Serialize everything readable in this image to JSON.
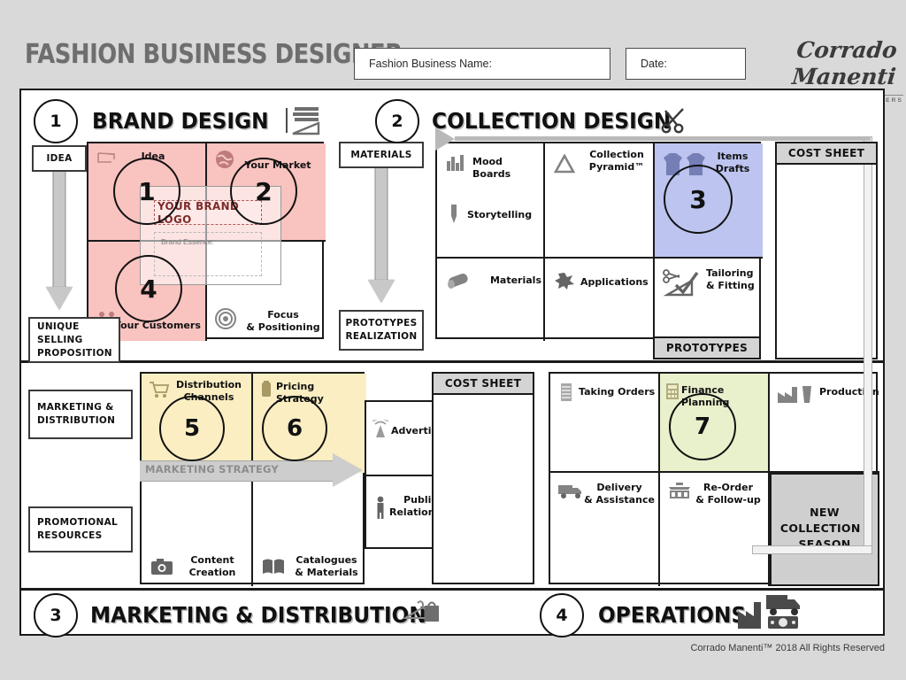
{
  "header": {
    "title": "FASHION BUSINESS DESIGNER",
    "business_name_field": {
      "label": "Fashion Business Name:",
      "value": ""
    },
    "date_field": {
      "label": "Date:",
      "value": ""
    },
    "logo": {
      "name": "Corrado Manenti",
      "tagline": "DESIGNER OF DESIGNERS"
    }
  },
  "sections": {
    "brand_design": {
      "number": "1",
      "title": "BRAND DESIGN"
    },
    "collection_design": {
      "number": "2",
      "title": "COLLECTION DESIGN"
    },
    "marketing_distribution": {
      "number": "3",
      "title": "MARKETING & DISTRIBUTION"
    },
    "operations": {
      "number": "4",
      "title": "OPERATIONS"
    }
  },
  "flow_boxes": {
    "idea": "IDEA",
    "unique_selling_proposition": "UNIQUE SELLING PROPOSITION",
    "marketing_distribution": "MARKETING & DISTRIBUTION",
    "promotional_resources": "PROMOTIONAL RESOURCES",
    "materials": "MATERIALS",
    "prototypes_realization": "PROTOTYPES REALIZATION"
  },
  "brand_grid": {
    "cells": [
      {
        "label": "Idea",
        "icon": "compass-icon"
      },
      {
        "label": "Your Market",
        "icon": "globe-icon"
      },
      {
        "label": "Your Customers",
        "icon": "people-icon"
      },
      {
        "label": "Focus\n& Positioning",
        "icon": "target-icon"
      }
    ],
    "logo_placeholder": "YOUR BRAND LOGO",
    "brand_essence_label": "Brand Essence:"
  },
  "collection_grid": {
    "cells": [
      {
        "label": "Mood Boards",
        "icon": "moodboard-icon"
      },
      {
        "label": "Storytelling",
        "icon": "pen-icon"
      },
      {
        "label": "Collection\nPyramid™",
        "icon": "triangle-icon"
      },
      {
        "label": "Applications",
        "icon": "splatter-icon"
      },
      {
        "label": "Items\nDrafts",
        "icon": "garments-icon"
      },
      {
        "label": "Tailoring\n& Fitting",
        "icon": "scissors-ruler-icon"
      },
      {
        "label": "Materials",
        "icon": "fabric-roll-icon"
      }
    ],
    "prototypes_banner": "PROTOTYPES",
    "cost_sheet_banner": "COST SHEET"
  },
  "marketing_grid": {
    "cells": [
      {
        "label": "Distribution\nChannels",
        "icon": "cart-icon"
      },
      {
        "label": "Pricing Strategy",
        "icon": "pricetag-icon"
      },
      {
        "label": "Content\nCreation",
        "icon": "camera-icon"
      },
      {
        "label": "Catalogues\n& Materials",
        "icon": "book-icon"
      },
      {
        "label": "Advertising",
        "icon": "broadcast-icon"
      },
      {
        "label": "Public\nRelationship",
        "icon": "person-icon"
      }
    ],
    "strategy_label": "MARKETING STRATEGY",
    "cost_sheet_banner": "COST SHEET"
  },
  "operations_grid": {
    "cells": [
      {
        "label": "Taking Orders",
        "icon": "ledger-icon"
      },
      {
        "label": "Finance Planning",
        "icon": "calculator-icon"
      },
      {
        "label": "Production",
        "icon": "factory-icon"
      },
      {
        "label": "Delivery\n& Assistance",
        "icon": "truck-icon"
      },
      {
        "label": "Re-Order\n& Follow-up",
        "icon": "store-icon"
      }
    ],
    "new_collection_banner": "NEW COLLECTION / SEASON"
  },
  "steps": [
    {
      "n": "1"
    },
    {
      "n": "2"
    },
    {
      "n": "3"
    },
    {
      "n": "4"
    },
    {
      "n": "5"
    },
    {
      "n": "6"
    },
    {
      "n": "7"
    }
  ],
  "footer": "Corrado Manenti™ 2018 All Rights Reserved",
  "colors": {
    "pink": "#f9c3c0",
    "blue": "#bcc4ef",
    "yellow": "#faeec2",
    "green": "#e9f0cc",
    "page_bg": "#d9d9d9",
    "banner_gray": "#d4d4d4",
    "title_gray": "#6e6e6e"
  }
}
